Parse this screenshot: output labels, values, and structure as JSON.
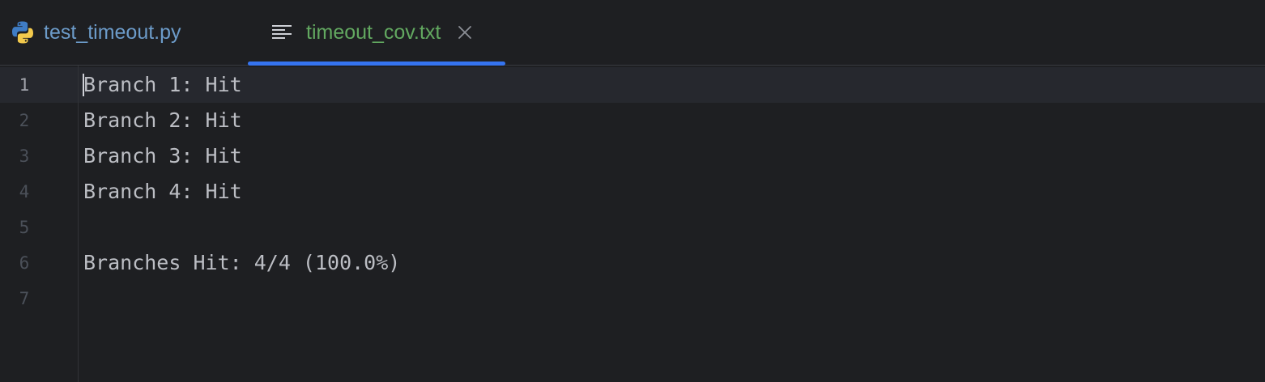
{
  "tabs": [
    {
      "label": "test_timeout.py",
      "icon": "python-file-icon",
      "active": false
    },
    {
      "label": "timeout_cov.txt",
      "icon": "text-file-icon",
      "active": true,
      "close_icon": "close-icon"
    }
  ],
  "colors": {
    "background": "#1e1f22",
    "active_tab_underline": "#3574f0",
    "python_tab_label": "#6c9bc9",
    "active_tab_label": "#62a860",
    "code_text": "#bcbec4",
    "line_number": "#4b5059",
    "current_line_number": "#a1a3ab"
  },
  "editor": {
    "current_line": 1,
    "lines": [
      {
        "number": "1",
        "text": "Branch 1: Hit"
      },
      {
        "number": "2",
        "text": "Branch 2: Hit"
      },
      {
        "number": "3",
        "text": "Branch 3: Hit"
      },
      {
        "number": "4",
        "text": "Branch 4: Hit"
      },
      {
        "number": "5",
        "text": ""
      },
      {
        "number": "6",
        "text": "Branches Hit: 4/4 (100.0%)"
      },
      {
        "number": "7",
        "text": ""
      }
    ]
  }
}
